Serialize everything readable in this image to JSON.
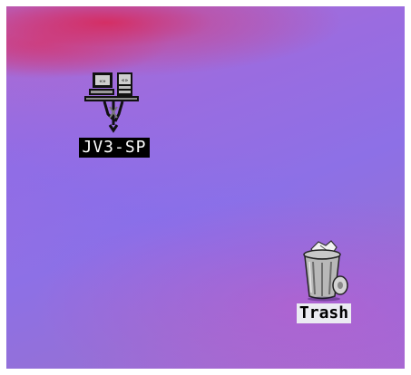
{
  "desktop": {
    "icons": [
      {
        "label": "JV3-SP",
        "icon": "file-server-icon",
        "selected": true
      },
      {
        "label": "Trash",
        "icon": "trash-icon",
        "selected": false
      }
    ]
  }
}
